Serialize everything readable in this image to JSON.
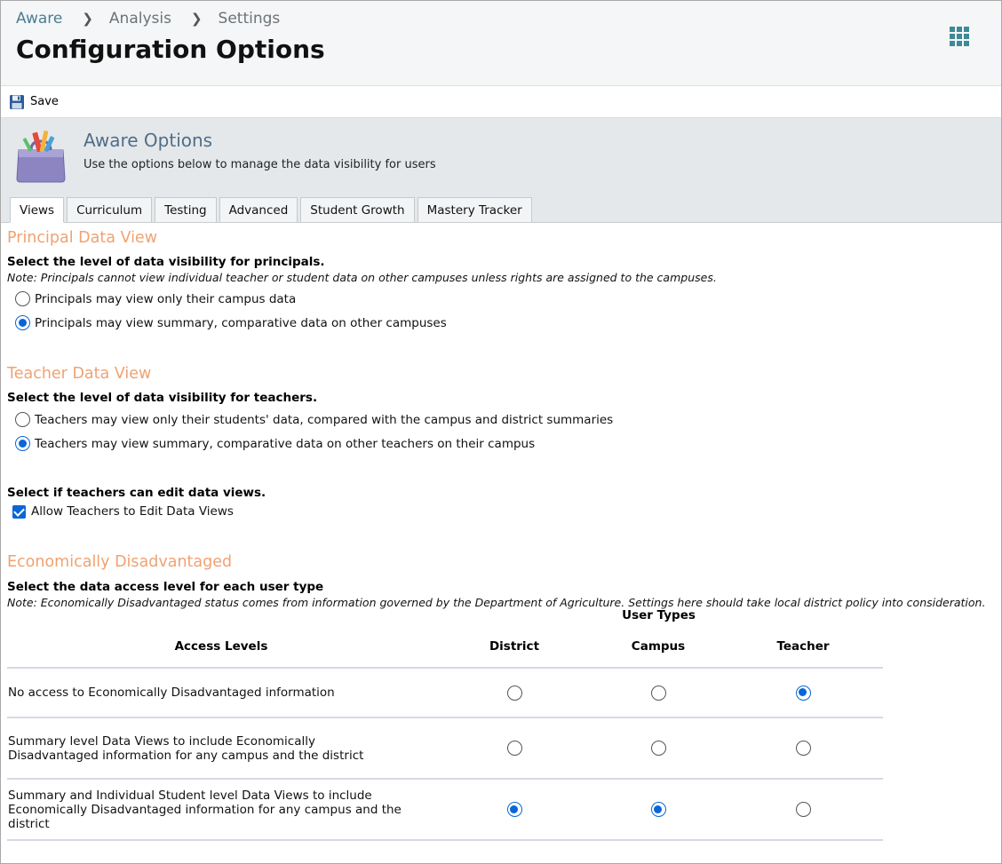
{
  "breadcrumb": [
    "Aware",
    "Analysis",
    "Settings"
  ],
  "page_title": "Configuration Options",
  "toolbar": {
    "save_label": "Save"
  },
  "panel": {
    "title": "Aware Options",
    "description": "Use the options below to manage the data visibility for users"
  },
  "tabs": [
    "Views",
    "Curriculum",
    "Testing",
    "Advanced",
    "Student Growth",
    "Mastery Tracker"
  ],
  "active_tab": "Views",
  "principal": {
    "title": "Principal Data View",
    "question": "Select the level of data visibility for principals.",
    "note": "Note: Principals cannot view individual teacher or student data on other campuses unless rights are assigned to the campuses.",
    "options": [
      {
        "label": "Principals may view only their campus data",
        "selected": false
      },
      {
        "label": "Principals may view summary, comparative data on other campuses",
        "selected": true
      }
    ]
  },
  "teacher": {
    "title": "Teacher Data View",
    "question": "Select the level of data visibility for teachers.",
    "options": [
      {
        "label": "Teachers may view only their students' data, compared with the campus and district summaries",
        "selected": false
      },
      {
        "label": "Teachers may view summary, comparative data on other teachers on their campus",
        "selected": true
      }
    ],
    "edit_question": "Select if teachers can edit data views.",
    "edit_checkbox_label": "Allow Teachers to Edit Data Views",
    "edit_checked": true
  },
  "econ": {
    "title": "Economically Disadvantaged",
    "question": "Select the data access level for each user type",
    "note": "Note: Economically Disadvantaged status comes from information governed by the Department of Agriculture. Settings here should take local district policy into consideration.",
    "user_types_label": "User Types",
    "access_levels_label": "Access Levels",
    "columns": [
      "District",
      "Campus",
      "Teacher"
    ],
    "rows": [
      {
        "label": "No access to Economically Disadvantaged information",
        "selected": [
          false,
          false,
          true
        ]
      },
      {
        "label": "Summary level Data Views to include Economically Disadvantaged information for any campus and the district",
        "selected": [
          false,
          false,
          false
        ]
      },
      {
        "label": "Summary and Individual Student level Data Views to include Economically Disadvantaged information for any campus and the district",
        "selected": [
          true,
          true,
          false
        ]
      }
    ]
  },
  "colors": {
    "accent_orange": "#f0a271",
    "link_teal": "#4b7e94",
    "radio_blue": "#0a66d6"
  },
  "icons": {
    "apps": "grid-icon",
    "save": "floppy-disk-icon",
    "options": "toolbox-icon"
  }
}
